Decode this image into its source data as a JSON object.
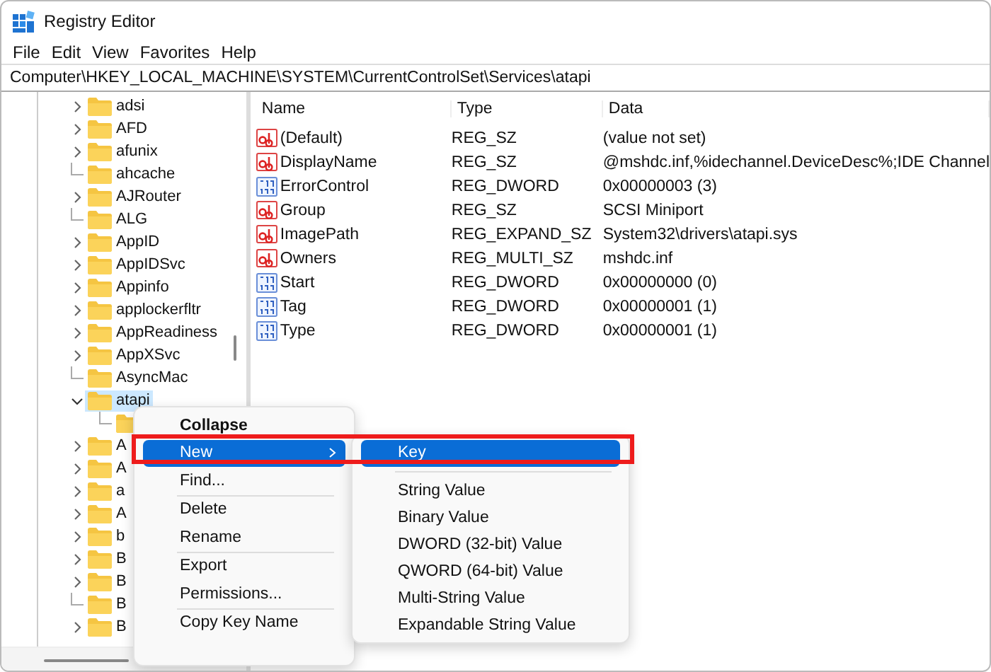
{
  "window": {
    "title": "Registry Editor"
  },
  "menu_bar": [
    "File",
    "Edit",
    "View",
    "Favorites",
    "Help"
  ],
  "address": "Computer\\HKEY_LOCAL_MACHINE\\SYSTEM\\CurrentControlSet\\Services\\atapi",
  "tree": [
    {
      "label": "adsi",
      "kind": "collapsed",
      "selected": false
    },
    {
      "label": "AFD",
      "kind": "collapsed",
      "selected": false
    },
    {
      "label": "afunix",
      "kind": "collapsed",
      "selected": false
    },
    {
      "label": "ahcache",
      "kind": "leaf",
      "selected": false
    },
    {
      "label": "AJRouter",
      "kind": "collapsed",
      "selected": false
    },
    {
      "label": "ALG",
      "kind": "leaf",
      "selected": false
    },
    {
      "label": "AppID",
      "kind": "collapsed",
      "selected": false
    },
    {
      "label": "AppIDSvc",
      "kind": "collapsed",
      "selected": false
    },
    {
      "label": "Appinfo",
      "kind": "collapsed",
      "selected": false
    },
    {
      "label": "applockerfltr",
      "kind": "collapsed",
      "selected": false
    },
    {
      "label": "AppReadiness",
      "kind": "collapsed",
      "selected": false
    },
    {
      "label": "AppXSvc",
      "kind": "collapsed",
      "selected": false
    },
    {
      "label": "AsyncMac",
      "kind": "leaf",
      "selected": false
    },
    {
      "label": "atapi",
      "kind": "expanded",
      "selected": true,
      "children": [
        {
          "kind": "leaf",
          "selected": false
        }
      ]
    },
    {
      "label": "A",
      "kind": "collapsed",
      "selected": false
    },
    {
      "label": "A",
      "kind": "collapsed",
      "selected": false
    },
    {
      "label": "a",
      "kind": "collapsed",
      "selected": false
    },
    {
      "label": "A",
      "kind": "collapsed",
      "selected": false
    },
    {
      "label": "b",
      "kind": "collapsed",
      "selected": false
    },
    {
      "label": "B",
      "kind": "collapsed",
      "selected": false
    },
    {
      "label": "B",
      "kind": "collapsed",
      "selected": false
    },
    {
      "label": "B",
      "kind": "leaf",
      "selected": false
    },
    {
      "label": "B",
      "kind": "collapsed",
      "selected": false
    }
  ],
  "values": {
    "columns": [
      "Name",
      "Type",
      "Data"
    ],
    "rows": [
      {
        "kind": "string",
        "name": "(Default)",
        "type": "REG_SZ",
        "data": "(value not set)"
      },
      {
        "kind": "string",
        "name": "DisplayName",
        "type": "REG_SZ",
        "data": "@mshdc.inf,%idechannel.DeviceDesc%;IDE Channel"
      },
      {
        "kind": "binary",
        "name": "ErrorControl",
        "type": "REG_DWORD",
        "data": "0x00000003 (3)"
      },
      {
        "kind": "string",
        "name": "Group",
        "type": "REG_SZ",
        "data": "SCSI Miniport"
      },
      {
        "kind": "string",
        "name": "ImagePath",
        "type": "REG_EXPAND_SZ",
        "data": "System32\\drivers\\atapi.sys"
      },
      {
        "kind": "string",
        "name": "Owners",
        "type": "REG_MULTI_SZ",
        "data": "mshdc.inf"
      },
      {
        "kind": "binary",
        "name": "Start",
        "type": "REG_DWORD",
        "data": "0x00000000 (0)"
      },
      {
        "kind": "binary",
        "name": "Tag",
        "type": "REG_DWORD",
        "data": "0x00000001 (1)"
      },
      {
        "kind": "binary",
        "name": "Type",
        "type": "REG_DWORD",
        "data": "0x00000001 (1)"
      }
    ]
  },
  "context_menu": [
    {
      "kind": "item",
      "label": "Collapse",
      "bold": true,
      "selected": false
    },
    {
      "kind": "submenu",
      "label": "New",
      "bold": false,
      "selected": true
    },
    {
      "kind": "item",
      "label": "Find...",
      "bold": false,
      "selected": false
    },
    {
      "kind": "separator"
    },
    {
      "kind": "item",
      "label": "Delete",
      "bold": false,
      "selected": false
    },
    {
      "kind": "item",
      "label": "Rename",
      "bold": false,
      "selected": false
    },
    {
      "kind": "separator"
    },
    {
      "kind": "item",
      "label": "Export",
      "bold": false,
      "selected": false
    },
    {
      "kind": "item",
      "label": "Permissions...",
      "bold": false,
      "selected": false
    },
    {
      "kind": "separator"
    },
    {
      "kind": "item",
      "label": "Copy Key Name",
      "bold": false,
      "selected": false
    }
  ],
  "submenu": [
    {
      "kind": "item",
      "label": "Key",
      "selected": true
    },
    {
      "kind": "separator"
    },
    {
      "kind": "item",
      "label": "String Value",
      "selected": false
    },
    {
      "kind": "item",
      "label": "Binary Value",
      "selected": false
    },
    {
      "kind": "item",
      "label": "DWORD (32-bit) Value",
      "selected": false
    },
    {
      "kind": "item",
      "label": "QWORD (64-bit) Value",
      "selected": false
    },
    {
      "kind": "item",
      "label": "Multi-String Value",
      "selected": false
    },
    {
      "kind": "item",
      "label": "Expandable String Value",
      "selected": false
    }
  ],
  "annotation": {
    "kind": "frame",
    "color": "#ee1c1c"
  }
}
